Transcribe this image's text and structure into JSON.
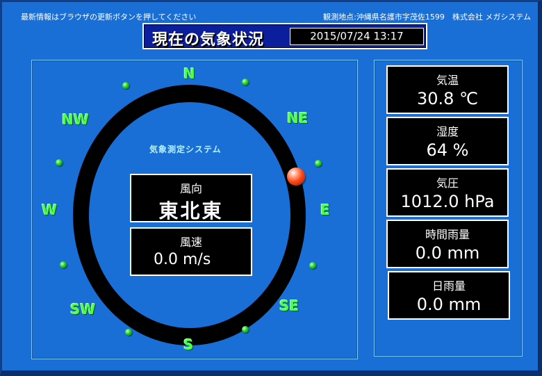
{
  "header": {
    "notice": "最新情報はブラウザの更新ボタンを押してください",
    "location": "観測地点:沖縄県名護市字茂佐1599　株式会社 メガシステム"
  },
  "titlebar": {
    "title": "現在の気象状況",
    "datetime": "2015/07/24 13:17"
  },
  "compass": {
    "system_label": "気象測定システム",
    "directions": {
      "n": "N",
      "ne": "NE",
      "e": "E",
      "se": "SE",
      "s": "S",
      "sw": "SW",
      "w": "W",
      "nw": "NW"
    },
    "wind_direction": {
      "label": "風向",
      "value": "東北東"
    },
    "wind_speed": {
      "label": "風速",
      "value": "0.0 m/s"
    }
  },
  "readings": {
    "temperature": {
      "label": "気温",
      "value": "30.8 ℃"
    },
    "humidity": {
      "label": "湿度",
      "value": "64 %"
    },
    "pressure": {
      "label": "気圧",
      "value": "1012.0 hPa"
    },
    "hourly_rain": {
      "label": "時間雨量",
      "value": "0.0 mm"
    },
    "daily_rain": {
      "label": "日雨量",
      "value": "0.0 mm"
    }
  },
  "colors": {
    "background": "#1a6fd6",
    "title_bar": "#0b1f9c",
    "direction_text": "#4dff4d",
    "indicator": "#ff4a1a"
  },
  "icons": {
    "wind_indicator": "red-ball-icon",
    "compass_markers": "green-dot-icon"
  }
}
